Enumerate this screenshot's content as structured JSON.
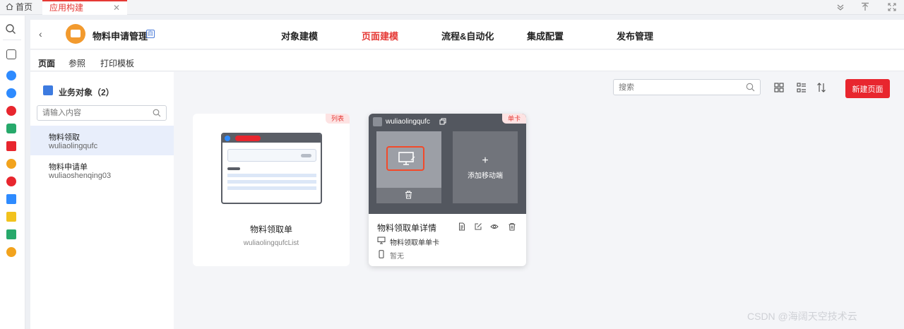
{
  "tabs": {
    "home_label": "首页",
    "app_label": "应用构建",
    "close_glyph": "✕"
  },
  "app": {
    "name": "物料申请管理",
    "badge": "自",
    "back_glyph": "‹"
  },
  "nav": [
    "对象建模",
    "页面建模",
    "流程&自动化",
    "集成配置",
    "发布管理"
  ],
  "nav_active_index": 1,
  "subtabs": [
    "页面",
    "参照",
    "打印模板"
  ],
  "objects": {
    "title": "业务对象（2）",
    "search_placeholder": "请输入内容",
    "items": [
      {
        "name": "物料领取",
        "code": "wuliaolingqufc"
      },
      {
        "name": "物料申请单",
        "code": "wuliaoshenqing03"
      }
    ]
  },
  "toolbar": {
    "search_placeholder": "搜索",
    "new_button": "新建页面"
  },
  "cards": {
    "list_card": {
      "tag": "列表",
      "title": "物料领取单",
      "code": "wuliaolingqufcList"
    },
    "detail_card": {
      "tag": "单卡",
      "code": "wuliaolingqufc",
      "add_mobile_plus": "+",
      "add_mobile_label": "添加移动端",
      "title": "物料领取单详情",
      "pc_label": "物料领取单单卡",
      "mobile_label": "暂无"
    }
  },
  "watermark": "CSDN @海阔天空技术云",
  "colors": {
    "accent_red": "#e8262e",
    "blue": "#3d7be0",
    "app_logo": "#f29a2e"
  }
}
